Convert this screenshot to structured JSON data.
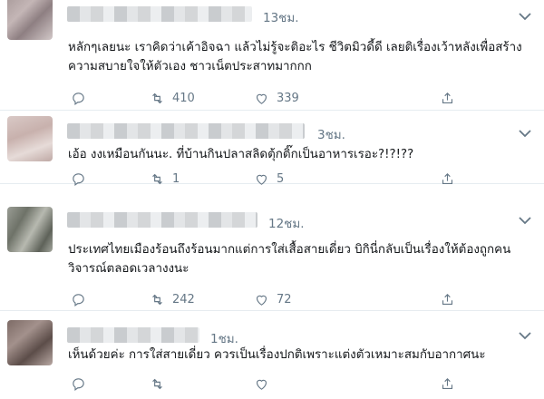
{
  "tweets": [
    {
      "time": "13ชม.",
      "text": "หลักๆเลยนะ เราคิดว่าเค้าอิจฉา แล้วไม่รู้จะติอะไร ชีวิตมิวดี้ดี เลยติเรื่องเว้าหลังเพื่อสร้างความสบายใจให้ตัวเอง ชาวเน็ตประสาทมากกก",
      "retweets": "410",
      "likes": "339"
    },
    {
      "time": "3ชม.",
      "text": "เอ้อ งงเหมือนกันนะ. ที่บ้านกินปลาสลิดตุ้กติ๊กเป็นอาหารเรอะ?!?!??",
      "retweets": "1",
      "likes": "5"
    },
    {
      "time": "12ชม.",
      "text": "ประเทศไทยเมืองร้อนถึงร้อนมากแต่การใส่เสื้อสายเดี่ยว บิกินี่กลับเป็นเรื่องให้ต้องถูกคนวิจารณ์ตลอดเวลางงนะ",
      "retweets": "242",
      "likes": "72"
    },
    {
      "time": "1ชม.",
      "text": "เห็นด้วยค่ะ การใส่สายเดี่ยว ควรเป็นเรื่องปกติเพราะแต่งตัวเหมาะสมกับอากาศนะ"
    }
  ],
  "icons": {
    "reply": "reply-icon",
    "retweet": "retweet-icon",
    "like": "heart-icon",
    "share": "share-icon",
    "menu": "chevron-down-icon"
  },
  "colors": {
    "muted": "#657786",
    "divider": "#e6ecf0",
    "text": "#14171a"
  }
}
